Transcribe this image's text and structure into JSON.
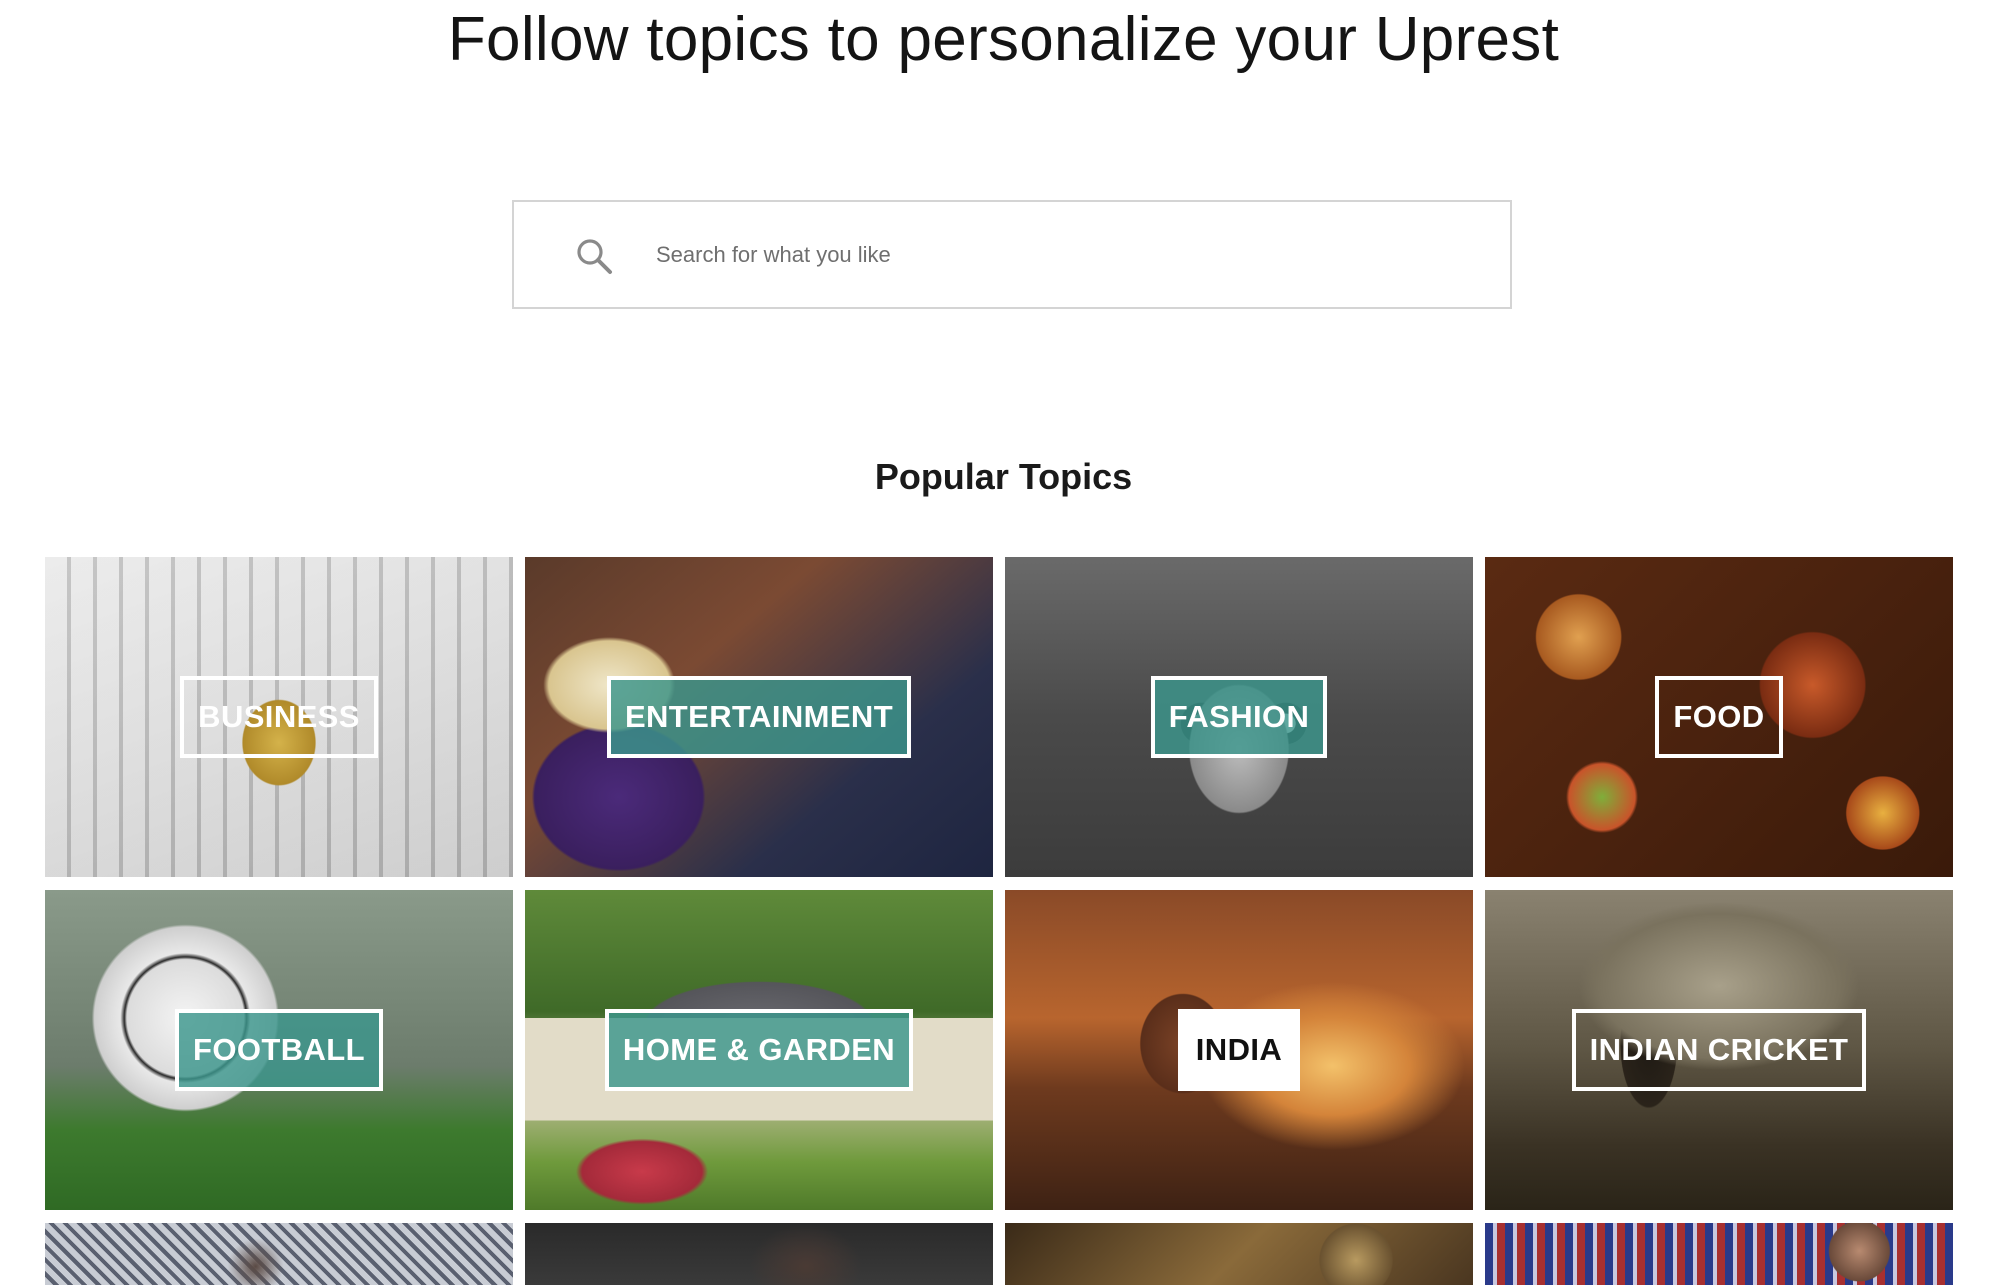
{
  "header": {
    "title": "Follow topics to personalize your Uprest"
  },
  "search": {
    "placeholder": "Search for what you like",
    "value": ""
  },
  "popular": {
    "title": "Popular Topics"
  },
  "topics": [
    {
      "label": "BUSINESS",
      "style": "plain"
    },
    {
      "label": "ENTERTAINMENT",
      "style": "teal"
    },
    {
      "label": "FASHION",
      "style": "teal"
    },
    {
      "label": "FOOD",
      "style": "plain"
    },
    {
      "label": "FOOTBALL",
      "style": "teal"
    },
    {
      "label": "HOME & GARDEN",
      "style": "teal"
    },
    {
      "label": "INDIA",
      "style": "selected"
    },
    {
      "label": "INDIAN CRICKET",
      "style": "plain"
    }
  ],
  "colors": {
    "accent_teal": "#3c968c",
    "border": "#d4d4d4",
    "text": "#1a1a1a"
  }
}
